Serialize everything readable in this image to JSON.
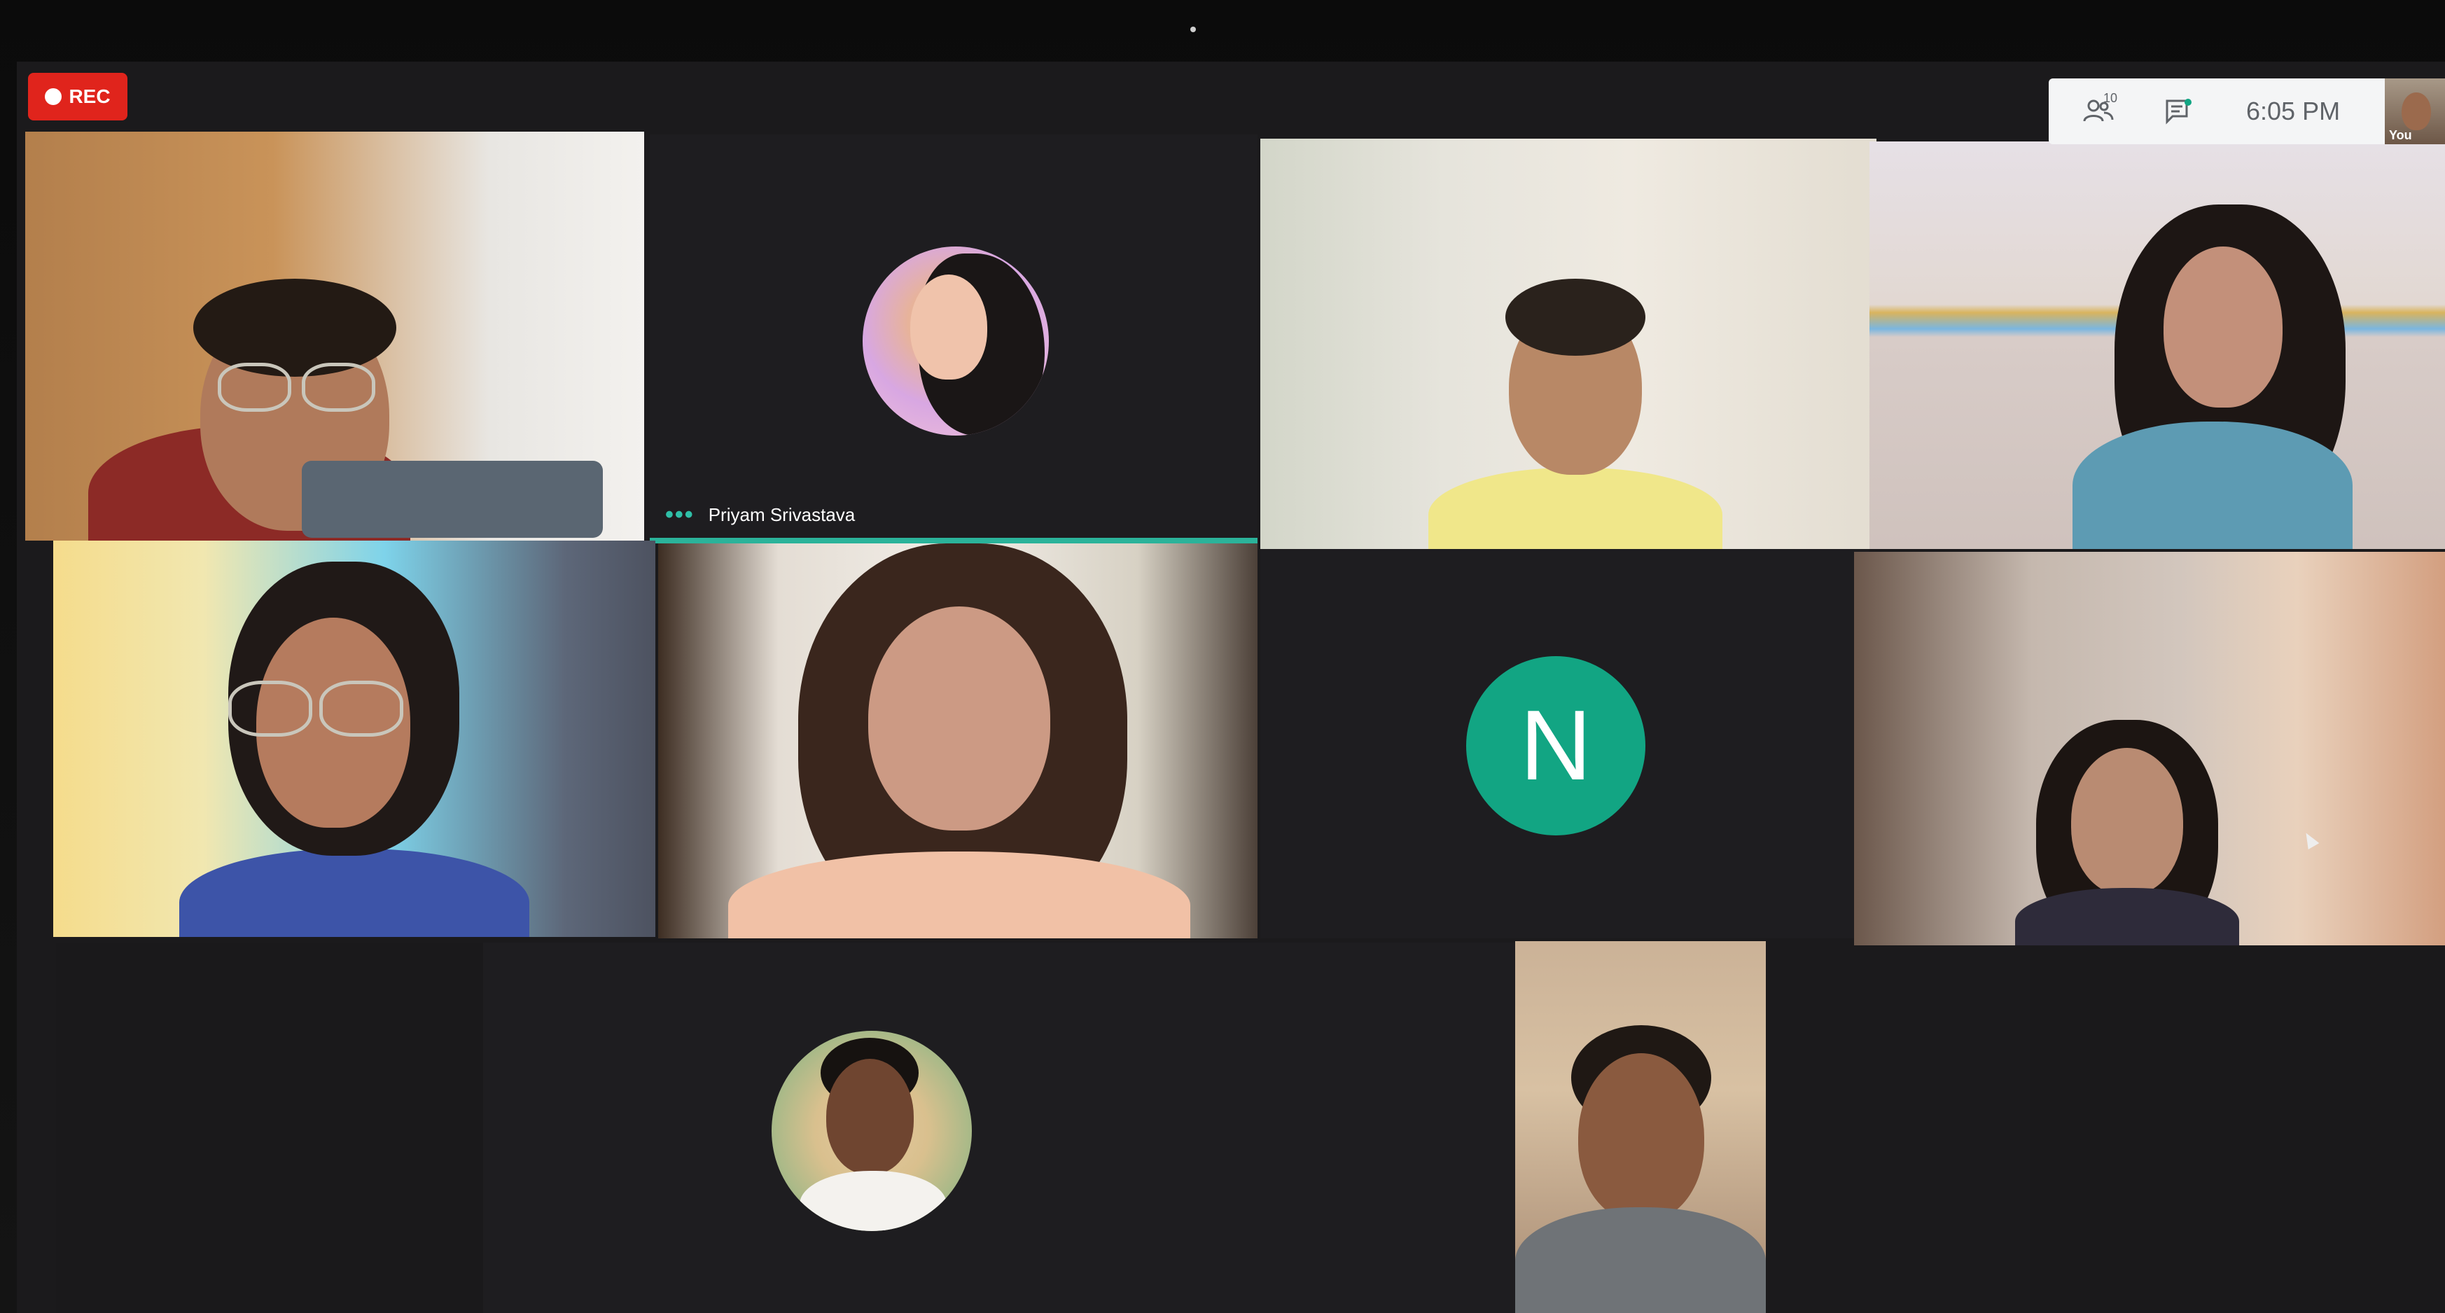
{
  "recording": {
    "label": "REC"
  },
  "top_panel": {
    "participants_count": "10",
    "time": "6:05 PM",
    "self_label": "You"
  },
  "participants": [
    {
      "name": "Priyam Srivastava"
    },
    {
      "initial": "N"
    }
  ],
  "colors": {
    "rec_red": "#e0241c",
    "active_speaker": "#2bb39a",
    "avatar_teal": "#12a583",
    "tile_bg": "#1e1d20"
  },
  "icons": [
    "record-dot-icon",
    "people-icon",
    "chat-icon",
    "more-dots-icon",
    "cursor-icon"
  ]
}
